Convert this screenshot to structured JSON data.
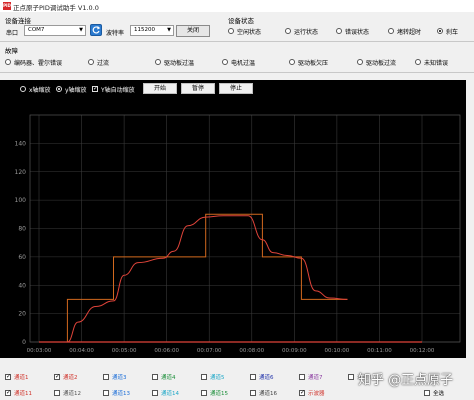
{
  "window": {
    "title": "正点原子PID调试助手 V1.0.0",
    "icon_text": "PID"
  },
  "connection": {
    "group_title": "设备连接",
    "port_label": "串口",
    "port_value": "COM7",
    "baud_label": "波特率",
    "baud_value": "115200",
    "close_button": "关闭"
  },
  "device_status": {
    "group_title": "设备状态",
    "options": [
      {
        "label": "空闲状态",
        "selected": false
      },
      {
        "label": "运行状态",
        "selected": false
      },
      {
        "label": "错误状态",
        "selected": false
      },
      {
        "label": "堵转超时",
        "selected": false
      },
      {
        "label": "刹车",
        "selected": true
      }
    ]
  },
  "faults": {
    "group_title": "故障",
    "options": [
      {
        "label": "编码器、霍尔错误",
        "selected": false
      },
      {
        "label": "过流",
        "selected": false
      },
      {
        "label": "驱动板过温",
        "selected": false
      },
      {
        "label": "电机过温",
        "selected": false
      },
      {
        "label": "驱动板欠压",
        "selected": false
      },
      {
        "label": "驱动板过流",
        "selected": false
      },
      {
        "label": "未知错误",
        "selected": false
      }
    ]
  },
  "plot_controls": {
    "x_axis_zoom": {
      "label": "x轴缩放",
      "selected": false
    },
    "y_axis_zoom": {
      "label": "y轴缩放",
      "selected": true
    },
    "auto_zoom": {
      "label": "Y轴自动缩放",
      "checked": true
    },
    "start_button": "开始",
    "pause_button": "暂停",
    "stop_button": "停止"
  },
  "chart_data": {
    "type": "line",
    "ylim": [
      0,
      160
    ],
    "yticks": [
      "0",
      "20",
      "40",
      "60",
      "80",
      "100",
      "120",
      "140"
    ],
    "xticks": [
      "00:03:00",
      "00:04:00",
      "00:05:00",
      "00:06:00",
      "00:07:00",
      "00:08:00",
      "00:09:00",
      "00:10:00",
      "00:11:00",
      "00:12:00"
    ],
    "series": [
      {
        "name": "通道1",
        "color": "#d2691e",
        "style": "step",
        "x": [
          "00:03:00",
          "00:03:40",
          "00:03:40",
          "00:04:45",
          "00:04:45",
          "00:05:55",
          "00:05:55",
          "00:06:55",
          "00:06:55",
          "00:07:40",
          "00:07:40",
          "00:08:15",
          "00:08:15",
          "00:09:10",
          "00:09:10",
          "00:10:15"
        ],
        "y": [
          0,
          0,
          30,
          30,
          60,
          60,
          60,
          60,
          90,
          90,
          90,
          90,
          60,
          60,
          30,
          30
        ]
      },
      {
        "name": "通道2",
        "color": "#e0443a",
        "style": "smooth",
        "x": [
          "00:03:00",
          "00:03:40",
          "00:03:55",
          "00:04:20",
          "00:04:45",
          "00:05:00",
          "00:05:20",
          "00:05:55",
          "00:06:10",
          "00:06:30",
          "00:06:55",
          "00:07:20",
          "00:07:40",
          "00:07:55",
          "00:08:15",
          "00:08:30",
          "00:08:50",
          "00:09:10",
          "00:09:30",
          "00:09:50",
          "00:10:15"
        ],
        "y": [
          0,
          0,
          14,
          25,
          29,
          47,
          56,
          59,
          64,
          82,
          88,
          89,
          89,
          89,
          72,
          63,
          61,
          59,
          36,
          31,
          30
        ]
      },
      {
        "name": "通道2-baseline",
        "color": "#e0443a",
        "style": "line",
        "x": [
          "00:03:00",
          "00:12:00"
        ],
        "y": [
          0,
          0
        ]
      }
    ]
  },
  "legend": {
    "row1": [
      {
        "label": "通道1",
        "color": "#d0342c",
        "checked": true
      },
      {
        "label": "通道2",
        "color": "#d0342c",
        "checked": true
      },
      {
        "label": "通道3",
        "color": "#1e6fd8",
        "checked": false
      },
      {
        "label": "通道4",
        "color": "#1c8f3a",
        "checked": false
      },
      {
        "label": "通道5",
        "color": "#1ea8c8",
        "checked": false
      },
      {
        "label": "通道6",
        "color": "#2233aa",
        "checked": false
      },
      {
        "label": "通道7",
        "color": "#8a3aa0",
        "checked": false
      },
      {
        "label": "通道8",
        "color": "#888888",
        "checked": false
      }
    ],
    "row2": [
      {
        "label": "通道11",
        "color": "#d0342c",
        "checked": true
      },
      {
        "label": "通道12",
        "color": "#555555",
        "checked": false
      },
      {
        "label": "通道13",
        "color": "#1e6fd8",
        "checked": false
      },
      {
        "label": "通道14",
        "color": "#1ea8c8",
        "checked": false
      },
      {
        "label": "通道15",
        "color": "#1c8f3a",
        "checked": false
      },
      {
        "label": "通道16",
        "color": "#444444",
        "checked": false
      },
      {
        "label": "示波器",
        "color": "#d0342c",
        "checked": true
      }
    ],
    "select_all": {
      "label": "全选",
      "checked": false
    }
  },
  "watermark": "知乎 @正点原子"
}
